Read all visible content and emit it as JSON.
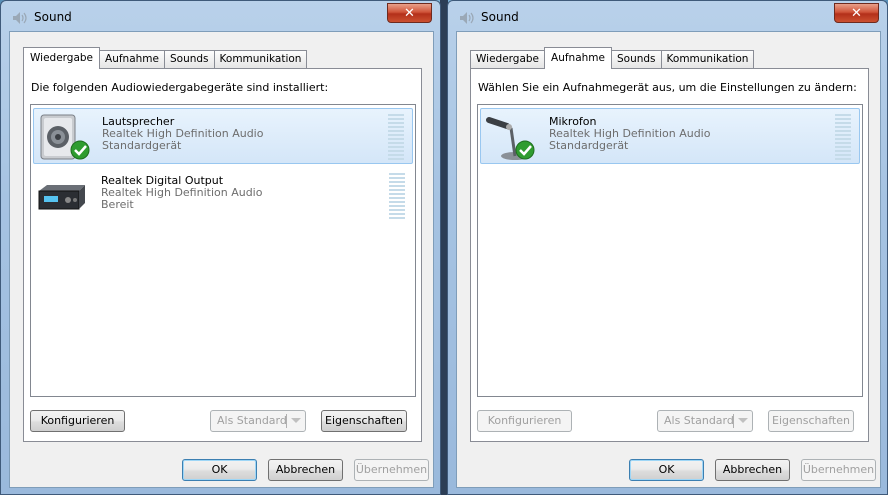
{
  "windows": [
    {
      "title": "Sound",
      "tabs": [
        "Wiedergabe",
        "Aufnahme",
        "Sounds",
        "Kommunikation"
      ],
      "active_tab": 0,
      "instruction": "Die folgenden Audiowiedergabegeräte sind installiert:",
      "devices": [
        {
          "name": "Lautsprecher",
          "driver": "Realtek High Definition Audio",
          "status": "Standardgerät",
          "icon": "speaker-icon",
          "selected": true,
          "default": true
        },
        {
          "name": "Realtek Digital Output",
          "driver": "Realtek High Definition Audio",
          "status": "Bereit",
          "icon": "digital-output-icon",
          "selected": false,
          "default": false
        }
      ],
      "buttons": {
        "configure": "Konfigurieren",
        "set_default": "Als Standard",
        "properties": "Eigenschaften",
        "ok": "OK",
        "cancel": "Abbrechen",
        "apply": "Übernehmen"
      }
    },
    {
      "title": "Sound",
      "tabs": [
        "Wiedergabe",
        "Aufnahme",
        "Sounds",
        "Kommunikation"
      ],
      "active_tab": 1,
      "instruction": "Wählen Sie ein Aufnahmegerät aus, um die Einstellungen zu ändern:",
      "devices": [
        {
          "name": "Mikrofon",
          "driver": "Realtek High Definition Audio",
          "status": "Standardgerät",
          "icon": "microphone-icon",
          "selected": true,
          "default": true
        }
      ],
      "buttons": {
        "configure": "Konfigurieren",
        "set_default": "Als Standard",
        "properties": "Eigenschaften",
        "ok": "OK",
        "cancel": "Abbrechen",
        "apply": "Übernehmen"
      }
    }
  ],
  "colors": {
    "selection_bg": "#d4e6f8",
    "selection_border": "#99c7f0",
    "default_check": "#2f9c2f",
    "close_button": "#c8452c",
    "meter_bar": "#c5dbe9"
  }
}
